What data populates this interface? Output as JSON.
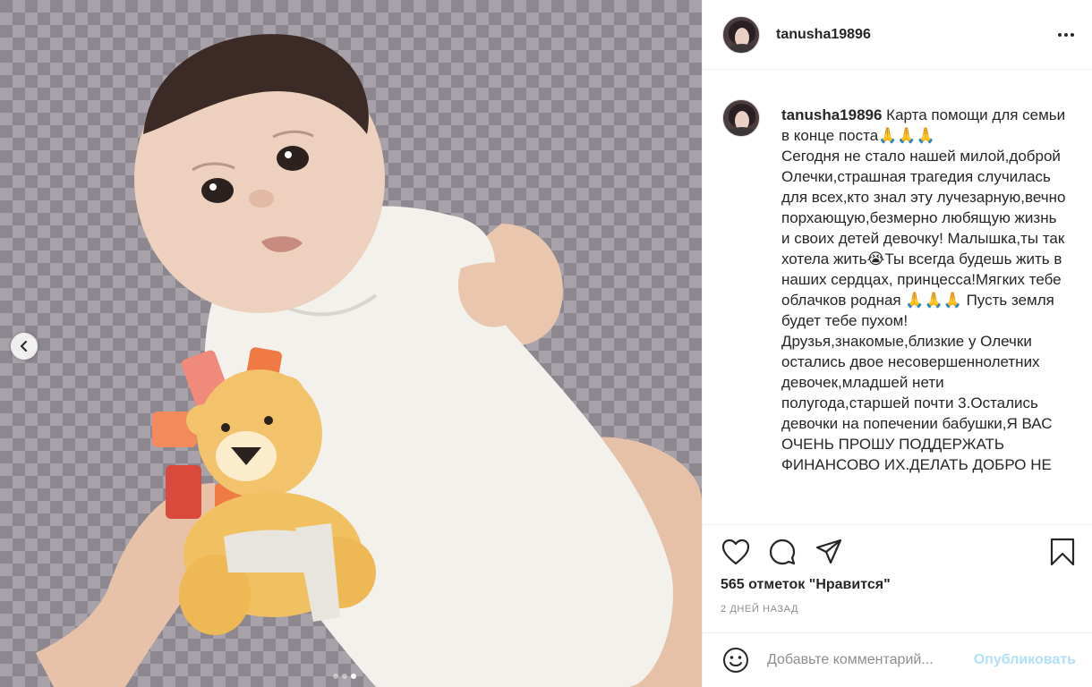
{
  "post": {
    "username": "tanusha19896",
    "more_icon": "more-horizontal-icon"
  },
  "caption": {
    "username": "tanusha19896",
    "text": " Карта помощи для семьи в конце поста🙏🙏🙏\nСегодня не стало нашей милой,доброй Олечки,страшная трагедия случилась для всех,кто знал эту лучезарную,вечно порхающую,безмерно любящую жизнь и своих детей девочку! Малышка,ты так хотела жить😭Ты всегда будешь жить в наших сердцах, принцесса!Мягких тебе облачков родная 🙏🙏🙏 Пусть земля будет тебе пухом!\nДрузья,знакомые,близкие у Олечки остались двое несовершеннолетних девочек,младшей нети полугода,старшей почти 3.Остались девочки на попечении бабушки,Я ВАС ОЧЕНЬ ПРОШУ ПОДДЕРЖАТЬ ФИНАНСОВО ИХ.ДЕЛАТЬ ДОБРО НЕ"
  },
  "actions": {
    "like_icon": "heart-icon",
    "comment_icon": "comment-icon",
    "share_icon": "send-icon",
    "save_icon": "bookmark-icon"
  },
  "likes_text": "565 отметок \"Нравится\"",
  "timestamp": "2 дней назад",
  "comment": {
    "placeholder": "Добавьте комментарий...",
    "post_label": "Опубликовать",
    "emoji_icon": "smiley-icon"
  },
  "carousel": {
    "total": 3,
    "active_index": 2
  },
  "colors": {
    "text": "#262626",
    "muted": "#8e8e8e",
    "border": "#efefef",
    "post_disabled": "#b2dffc"
  }
}
